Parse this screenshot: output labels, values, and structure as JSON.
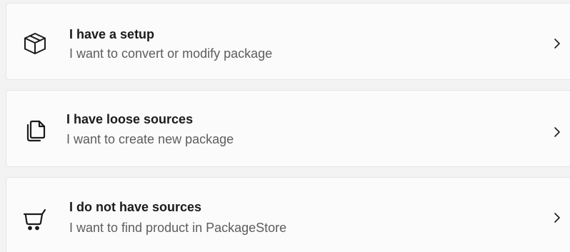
{
  "options": [
    {
      "icon": "package-box-icon",
      "title": "I have a setup",
      "subtitle": "I want to convert or modify package"
    },
    {
      "icon": "document-copy-icon",
      "title": "I have loose sources",
      "subtitle": "I want to create new package"
    },
    {
      "icon": "shopping-cart-icon",
      "title": "I do not have sources",
      "subtitle": "I want to find product in PackageStore"
    }
  ],
  "colors": {
    "background": "#f3f3f3",
    "card": "#fbfbfb",
    "border": "#e5e5e5",
    "title": "#1b1b1b",
    "subtitle": "#5d5d5d"
  }
}
